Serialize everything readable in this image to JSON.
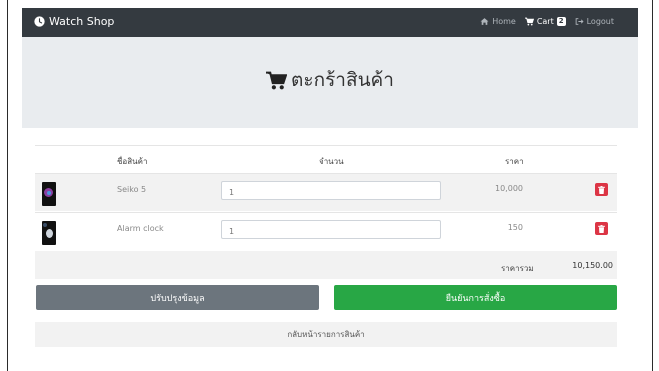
{
  "navbar": {
    "brand": "Watch Shop",
    "home": "Home",
    "cart": "Cart",
    "cart_count": "2",
    "logout": "Logout"
  },
  "page": {
    "title": "ตะกร้าสินค้า"
  },
  "table": {
    "headers": [
      "ชื่อสินค้า",
      "จำนวน",
      "ราคา"
    ],
    "rows": [
      {
        "name": "Seiko 5",
        "qty": "1",
        "price": "10,000"
      },
      {
        "name": "Alarm clock",
        "qty": "1",
        "price": "150"
      }
    ],
    "total_label": "ราคารวม",
    "total_value": "10,150.00"
  },
  "actions": {
    "update": "ปรับปรุงข้อมูล",
    "confirm": "ยืนยันการสั่งซื้อ",
    "back": "กลับหน้ารายการสินค้า"
  },
  "colors": {
    "navbar": "#343a40",
    "jumbotron": "#e9ecef",
    "update_button": "#6c757d",
    "confirm_button": "#28a745",
    "delete_button": "#dc3545"
  },
  "icons": {
    "brand": "clock-icon",
    "home": "home-icon",
    "cart": "cart-icon",
    "logout": "logout-icon",
    "title": "cart-icon",
    "delete": "trash-icon"
  }
}
